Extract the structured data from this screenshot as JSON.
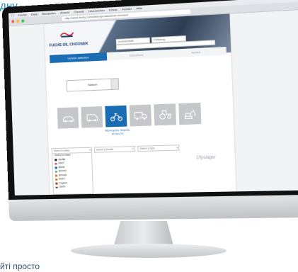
{
  "caption_top": "дну",
  "caption_bottom": "йті просто",
  "browser": {
    "menu": [
      "Firefox",
      "Datei",
      "Bearbeiten",
      "Ansicht",
      "Chronik",
      "Lesezeichen",
      "Extras",
      "Fenster",
      "Hilfe"
    ],
    "url": "http://www.fuchs.com/de/en/products/oil-chooser/"
  },
  "page": {
    "title": "FUCHS OIL CHOOSER",
    "hero_inputs": [
      "Schmierstoffe",
      "Fahrzeug"
    ],
    "tabs": [
      {
        "label": "Vehicle selection",
        "active": true
      },
      {
        "label": "Document",
        "active": false
      },
      {
        "label": "Advice",
        "active": false
      }
    ],
    "search_label": "Search",
    "categories": [
      {
        "icon": "car-icon",
        "active": false
      },
      {
        "icon": "van-icon",
        "active": false
      },
      {
        "icon": "motorcycle-icon",
        "active": true
      },
      {
        "icon": "truck-icon",
        "active": false
      },
      {
        "icon": "tractor-icon",
        "active": false
      },
      {
        "icon": "excavator-icon",
        "active": false
      }
    ],
    "active_category_label": "Motorcycles, Mopeds, ATVs/UTV",
    "selects": [
      "Select a make",
      "Select a model",
      "Select a type"
    ],
    "brands": [
      "Select a make",
      "Aprilia",
      "Ariel",
      "BMW",
      "Benelli",
      "Bimota",
      "Buell",
      "Cagiva",
      "Derbi"
    ],
    "watermark": "Olyslager"
  },
  "colors": {
    "accent": "#1b6db3",
    "caption_top": "#1a8fc4",
    "caption_bottom": "#3a4b73"
  }
}
